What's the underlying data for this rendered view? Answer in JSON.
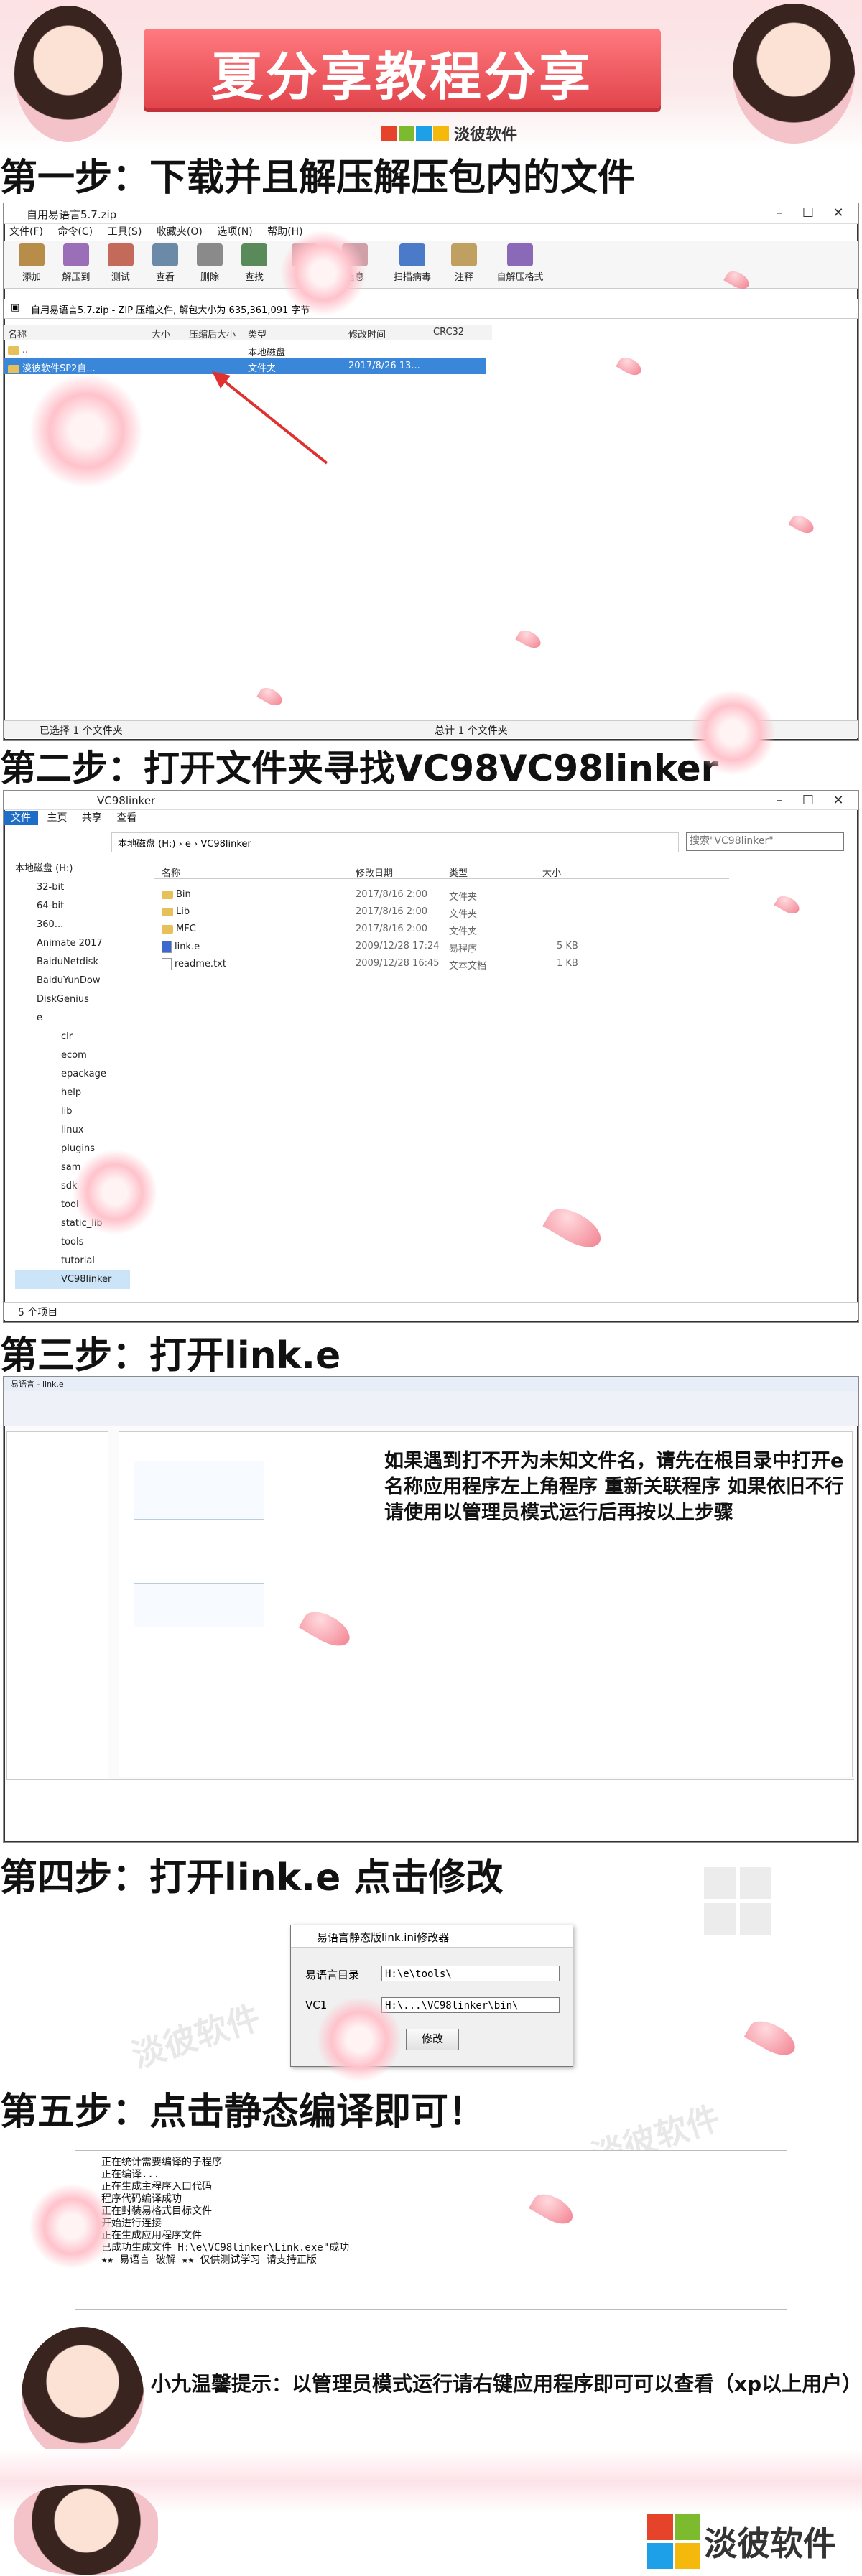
{
  "banner": {
    "title": "夏分享教程分享"
  },
  "logo": {
    "text": "淡彼软件"
  },
  "steps": {
    "step1": "第一步：下载并且解压解压包内的文件",
    "step2": "第二步：打开文件夹寻找VC98VC98linker",
    "step3": "第三步：打开link.e",
    "step4": "第四步：打开link.e 点击修改",
    "step5": "第五步：点击静态编译即可！"
  },
  "winrar": {
    "title": "自用易语言5.7.zip",
    "menu": [
      "文件(F)",
      "命令(C)",
      "工具(S)",
      "收藏夹(O)",
      "选项(N)",
      "帮助(H)"
    ],
    "tools": [
      "添加",
      "解压到",
      "测试",
      "查看",
      "删除",
      "查找",
      "向导",
      "信息",
      "扫描病毒",
      "注释",
      "自解压格式"
    ],
    "path": "自用易语言5.7.zip - ZIP 压缩文件, 解包大小为 635,361,091 字节",
    "columns": [
      "名称",
      "大小",
      "压缩后大小",
      "类型",
      "修改时间",
      "CRC32"
    ],
    "rows": [
      {
        "name": "..",
        "type": "本地磁盘",
        "date": ""
      },
      {
        "name": "淡彼软件SP2自...",
        "type": "文件夹",
        "date": "2017/8/26 13..."
      }
    ],
    "status_left": "已选择 1 个文件夹",
    "status_right": "总计 1 个文件夹"
  },
  "explorer": {
    "title": "VC98linker",
    "tabs": [
      "文件",
      "主页",
      "共享",
      "查看"
    ],
    "breadcrumb": [
      "本地磁盘 (H:)",
      "e",
      "VC98linker"
    ],
    "search_placeholder": "搜索\"VC98linker\"",
    "columns": [
      "名称",
      "修改日期",
      "类型",
      "大小"
    ],
    "tree": [
      "本地磁盘 (H:)",
      "32-bit",
      "64-bit",
      "360...",
      "Animate 2017",
      "BaiduNetdisk",
      "BaiduYunDow",
      "DiskGenius",
      "e",
      "clr",
      "ecom",
      "epackage",
      "help",
      "lib",
      "linux",
      "plugins",
      "sam",
      "sdk",
      "tool",
      "static_lib",
      "tools",
      "tutorial",
      "VC98linker"
    ],
    "files": [
      {
        "name": "Bin",
        "date": "2017/8/16 2:00",
        "type": "文件夹",
        "size": ""
      },
      {
        "name": "Lib",
        "date": "2017/8/16 2:00",
        "type": "文件夹",
        "size": ""
      },
      {
        "name": "MFC",
        "date": "2017/8/16 2:00",
        "type": "文件夹",
        "size": ""
      },
      {
        "name": "link.e",
        "date": "2009/12/28 17:24",
        "type": "易程序",
        "size": "5 KB"
      },
      {
        "name": "readme.txt",
        "date": "2009/12/28 16:45",
        "type": "文本文档",
        "size": "1 KB"
      }
    ],
    "status": "5 个项目"
  },
  "step3_note": "如果遇到打不开为未知文件名，请先在根目录中打开e名称应用程序左上角程序 重新关联程序 如果依旧不行请使用以管理员模式运行后再按以上步骤",
  "dialog": {
    "title": "易语言静态版link.ini修改器",
    "label1": "易语言目录",
    "value1": "H:\\e\\tools\\",
    "label2": "VC1",
    "value2": "H:\\...\\VC98linker\\bin\\",
    "button": "修改"
  },
  "console": {
    "lines": [
      "正在统计需要编译的子程序",
      "正在编译...",
      "正在生成主程序入口代码",
      "程序代码编译成功",
      "正在封装易格式目标文件",
      "开始进行连接",
      "正在生成应用程序文件",
      "已成功生成文件 H:\\e\\VC98linker\\Link.exe\"成功",
      "★★ 易语言 破解 ★★ 仅供测试学习 请支持正版"
    ]
  },
  "tip": "小九温馨提示：以管理员模式运行请右键应用程序即可可以查看（xp以上用户）",
  "footer_logo": "淡彼软件"
}
